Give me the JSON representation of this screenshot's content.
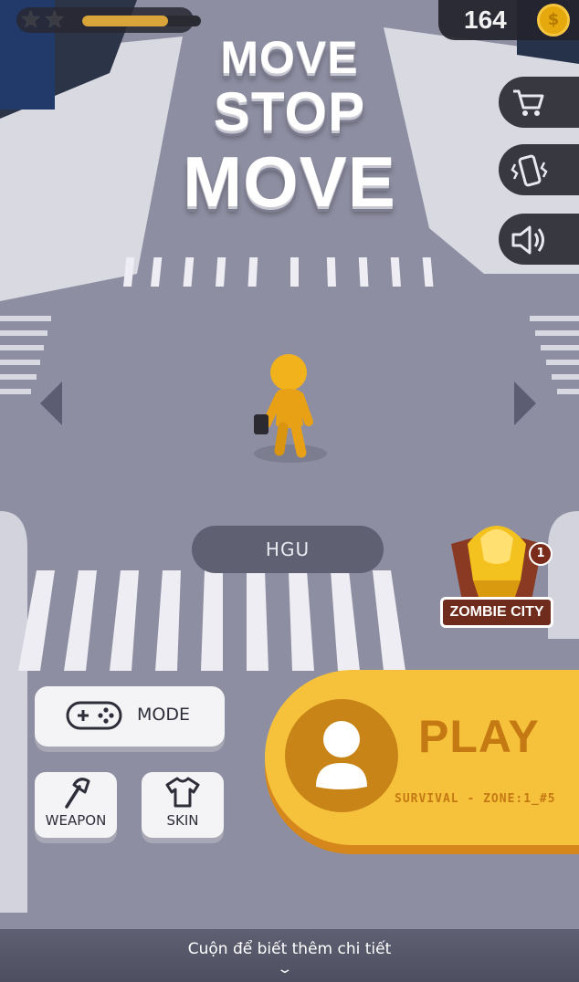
{
  "hud": {
    "stars": 2,
    "xp_progress": 0.72,
    "coins": "164",
    "coin_symbol": "$"
  },
  "title": {
    "line1": "MOVE",
    "line2": "STOP",
    "line3": "MOVE"
  },
  "side_buttons": [
    "cart-icon",
    "vibrate-icon",
    "sound-icon"
  ],
  "player": {
    "name": "HGU"
  },
  "zone": {
    "label": "ZOMBIE CITY",
    "count": "1"
  },
  "buttons": {
    "mode": "MODE",
    "weapon": "WEAPON",
    "skin": "SKIN"
  },
  "play": {
    "label": "PLAY",
    "subtitle": "SURVIVAL - ZONE:1_#5"
  },
  "footer": {
    "text": "Cuộn để biết thêm chi tiết"
  },
  "colors": {
    "road": "#8f8fa3",
    "play": "#f6c23c",
    "character": "#f2b21c"
  }
}
